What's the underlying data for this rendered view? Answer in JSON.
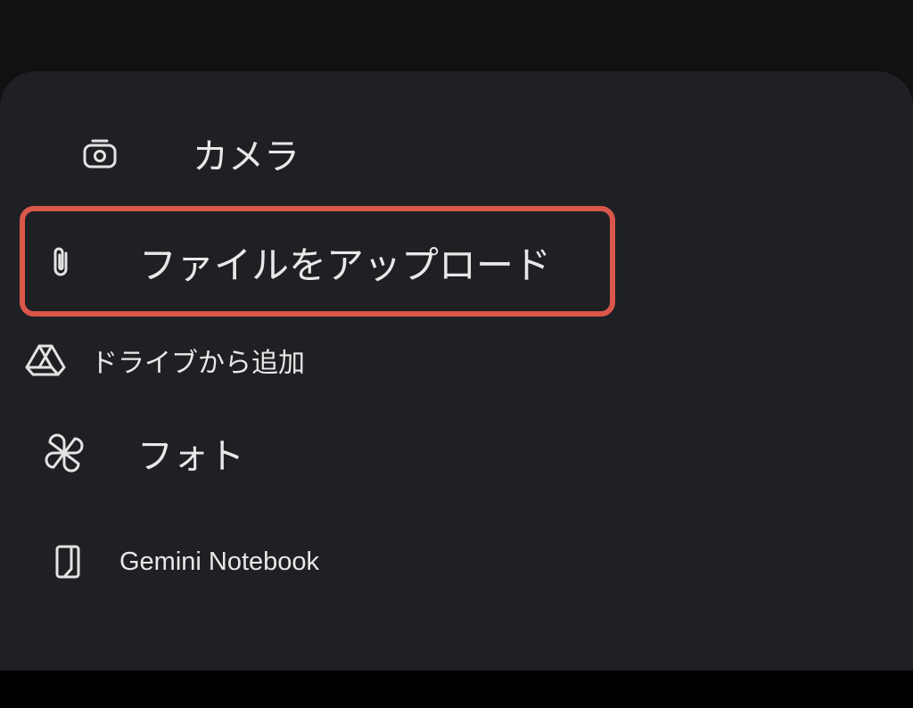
{
  "menu": {
    "items": [
      {
        "id": "camera",
        "label": "カメラ",
        "icon": "camera-icon"
      },
      {
        "id": "upload",
        "label": "ファイルをアップロード",
        "icon": "paperclip-icon",
        "highlighted": true
      },
      {
        "id": "drive",
        "label": "ドライブから追加",
        "icon": "drive-icon"
      },
      {
        "id": "photos",
        "label": "フォト",
        "icon": "photos-pinwheel-icon"
      },
      {
        "id": "notebook",
        "label": "Gemini Notebook",
        "icon": "notebook-icon"
      }
    ]
  },
  "colors": {
    "sheet_background": "#1f2023",
    "highlight_border": "#d9574a",
    "text": "#e8e8e8"
  }
}
